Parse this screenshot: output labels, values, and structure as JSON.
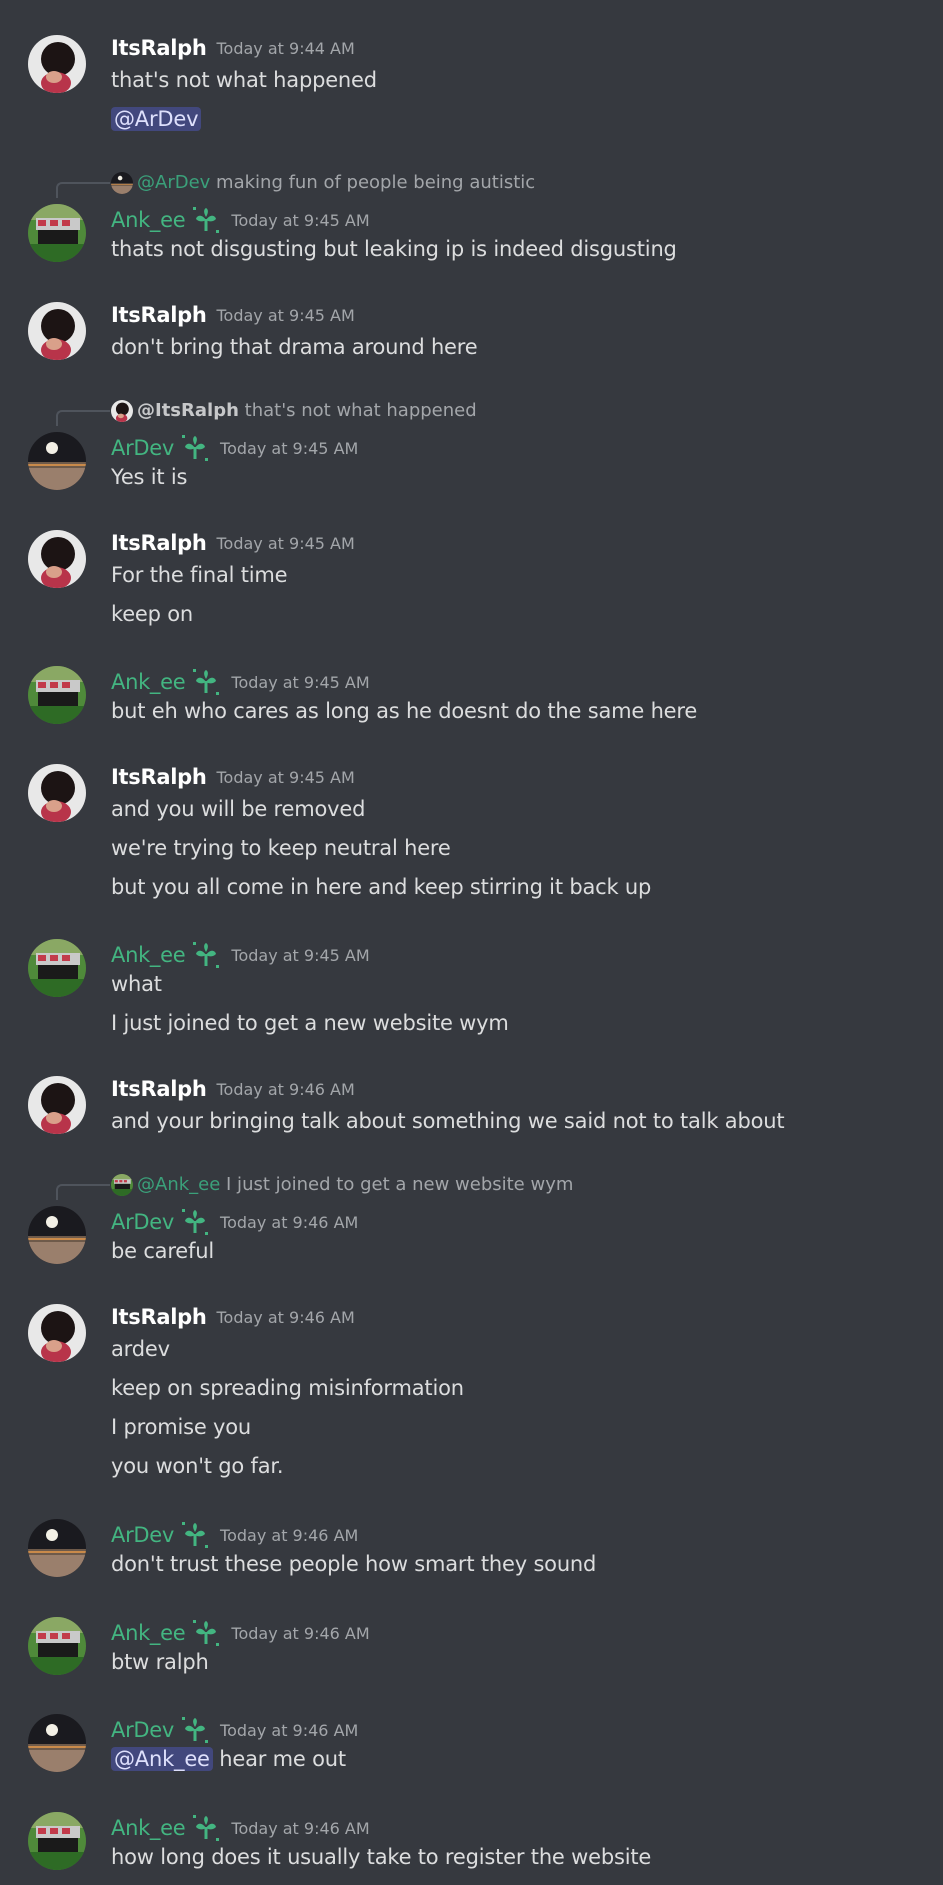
{
  "messages": [
    {
      "kind": "group",
      "user": "ItsRalph",
      "role": "ralph",
      "time": "Today at 9:44 AM",
      "lines": [
        "that's not what happened",
        {
          "mention": "@ArDev",
          "rest": ""
        }
      ]
    },
    {
      "kind": "group",
      "user": "Ank_ee",
      "role": "ank",
      "time": "Today at 9:45 AM",
      "reply": {
        "user": "@ArDev",
        "role": "ardev",
        "text": "making fun of people being autistic"
      },
      "lines": [
        "thats not disgusting but leaking ip is indeed disgusting"
      ]
    },
    {
      "kind": "group",
      "user": "ItsRalph",
      "role": "ralph",
      "time": "Today at 9:45 AM",
      "lines": [
        "don't bring that drama around here"
      ]
    },
    {
      "kind": "group",
      "user": "ArDev",
      "role": "ardev",
      "time": "Today at 9:45 AM",
      "reply": {
        "user": "@ItsRalph",
        "role": "ralph",
        "text": "that's not what happened"
      },
      "lines": [
        "Yes it is"
      ]
    },
    {
      "kind": "group",
      "user": "ItsRalph",
      "role": "ralph",
      "time": "Today at 9:45 AM",
      "lines": [
        "For the final time",
        "keep on"
      ]
    },
    {
      "kind": "group",
      "user": "Ank_ee",
      "role": "ank",
      "time": "Today at 9:45 AM",
      "lines": [
        "but eh who cares as long as he doesnt do the same here"
      ]
    },
    {
      "kind": "group",
      "user": "ItsRalph",
      "role": "ralph",
      "time": "Today at 9:45 AM",
      "lines": [
        "and you will be removed",
        "we're trying to keep neutral here",
        "but you all come in here and keep stirring it back up"
      ]
    },
    {
      "kind": "group",
      "user": "Ank_ee",
      "role": "ank",
      "time": "Today at 9:45 AM",
      "lines": [
        "what",
        "I just joined to get a new website wym"
      ]
    },
    {
      "kind": "group",
      "user": "ItsRalph",
      "role": "ralph",
      "time": "Today at 9:46 AM",
      "lines": [
        "and your bringing talk about something we said not to talk about"
      ]
    },
    {
      "kind": "group",
      "user": "ArDev",
      "role": "ardev",
      "time": "Today at 9:46 AM",
      "reply": {
        "user": "@Ank_ee",
        "role": "ank",
        "text": "I just joined to get a new website wym"
      },
      "lines": [
        "be careful"
      ]
    },
    {
      "kind": "group",
      "user": "ItsRalph",
      "role": "ralph",
      "time": "Today at 9:46 AM",
      "lines": [
        "ardev",
        "keep on spreading misinformation",
        "I promise you",
        "you won't go far."
      ]
    },
    {
      "kind": "group",
      "user": "ArDev",
      "role": "ardev",
      "time": "Today at 9:46 AM",
      "lines": [
        "don't trust these people how smart they sound"
      ]
    },
    {
      "kind": "group",
      "user": "Ank_ee",
      "role": "ank",
      "time": "Today at 9:46 AM",
      "lines": [
        "btw ralph"
      ]
    },
    {
      "kind": "group",
      "user": "ArDev",
      "role": "ardev",
      "time": "Today at 9:46 AM",
      "lines": [
        {
          "mention": "@Ank_ee",
          "rest": " hear me out"
        }
      ]
    },
    {
      "kind": "group",
      "user": "Ank_ee",
      "role": "ank",
      "time": "Today at 9:46 AM",
      "lines": [
        "how long does it usually take to register the website"
      ]
    }
  ],
  "icons": {
    "badge": "sprout-badge-icon",
    "avatars": {
      "ralph": "ralph-avatar",
      "ank": "ank-avatar",
      "ardev": "ardev-avatar"
    }
  },
  "colors": {
    "background": "#36393f",
    "username_green": "#43b581",
    "timestamp": "#a3a6aa",
    "text": "#dcddde",
    "mention_bg": "rgba(88,101,242,0.35)"
  }
}
